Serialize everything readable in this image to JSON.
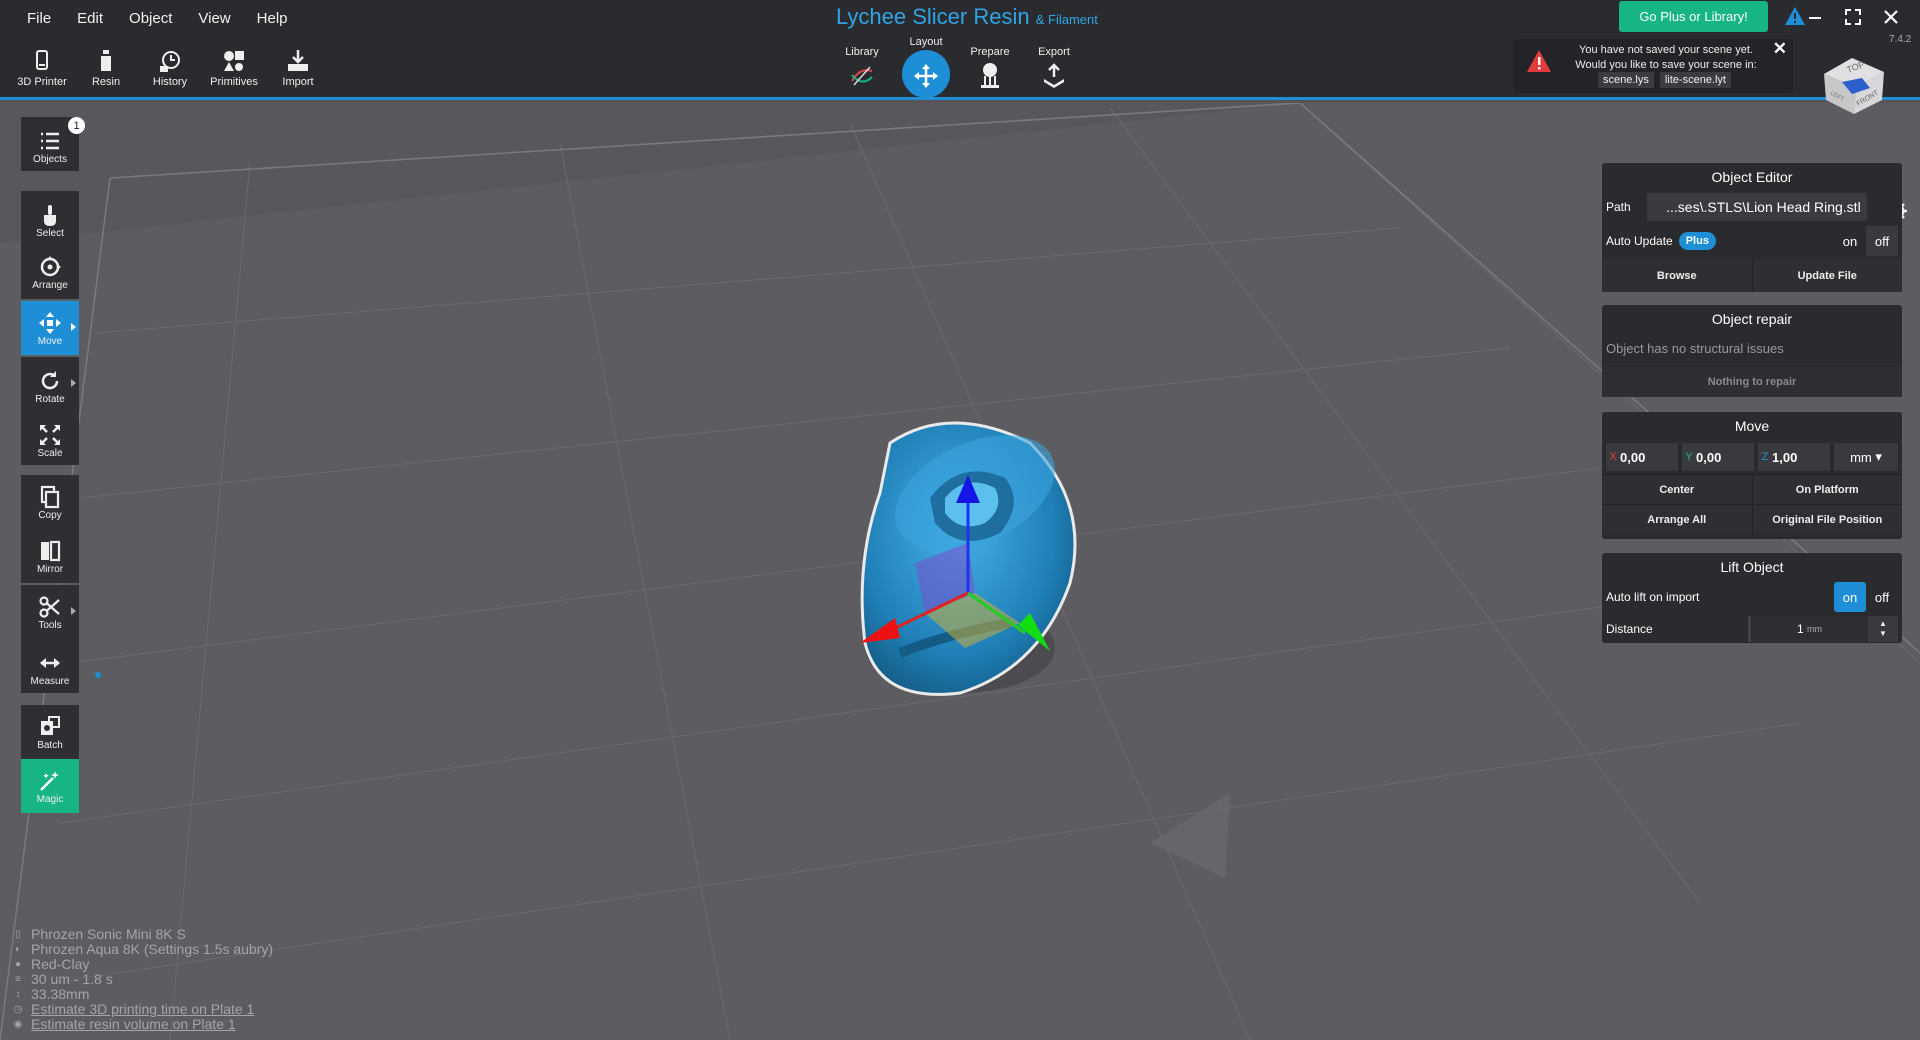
{
  "menu": [
    "File",
    "Edit",
    "Object",
    "View",
    "Help"
  ],
  "tools": [
    {
      "label": "3D Printer",
      "icon": "printer-icon"
    },
    {
      "label": "Resin",
      "icon": "resin-bottle-icon"
    },
    {
      "label": "History",
      "icon": "history-icon"
    },
    {
      "label": "Primitives",
      "icon": "primitives-icon"
    },
    {
      "label": "Import",
      "icon": "import-icon"
    }
  ],
  "app": {
    "title": "Lychee Slicer Resin",
    "suffix": "& Filament",
    "version": "7.4.2"
  },
  "workflow": [
    {
      "label": "Library",
      "icon": "library-icon"
    },
    {
      "label": "Layout",
      "icon": "move-icon",
      "active": true
    },
    {
      "label": "Prepare",
      "icon": "supports-icon"
    },
    {
      "label": "Export",
      "icon": "export-icon"
    }
  ],
  "go_plus": "Go Plus or Library!",
  "notification": {
    "message": "You have not saved your scene yet. Would you like to save your scene in:",
    "options": [
      "scene.lys",
      "lite-scene.lyt"
    ]
  },
  "view_cube": {
    "top": "TOP",
    "front": "FRONT",
    "left": "LEFT"
  },
  "sidebar": {
    "objects": {
      "label": "Objects",
      "count": "1"
    },
    "items": [
      {
        "label": "Select"
      },
      {
        "label": "Arrange"
      },
      {
        "label": "Move"
      },
      {
        "label": "Rotate"
      },
      {
        "label": "Scale"
      },
      {
        "label": "Copy"
      },
      {
        "label": "Mirror"
      },
      {
        "label": "Tools"
      },
      {
        "label": "Measure"
      },
      {
        "label": "Batch"
      },
      {
        "label": "Magic"
      }
    ]
  },
  "object_editor": {
    "title": "Object Editor",
    "path_label": "Path",
    "path_value": "...ses\\.STLS\\Lion Head Ring.stl",
    "auto_update_label": "Auto Update",
    "plus_badge": "Plus",
    "on": "on",
    "off": "off",
    "browse": "Browse",
    "update_file": "Update File"
  },
  "object_repair": {
    "title": "Object repair",
    "status": "Object has no structural issues",
    "button": "Nothing to repair"
  },
  "move": {
    "title": "Move",
    "x_label": "X",
    "x": "0,00",
    "y_label": "Y",
    "y": "0,00",
    "z_label": "Z",
    "z": "1,00",
    "unit": "mm",
    "center": "Center",
    "on_platform": "On Platform",
    "arrange_all": "Arrange All",
    "original_position": "Original File Position"
  },
  "lift_object": {
    "title": "Lift Object",
    "auto_lift_label": "Auto lift on import",
    "on": "on",
    "off": "off",
    "distance_label": "Distance",
    "distance_value": "1",
    "distance_unit": "mm"
  },
  "info": {
    "printer": "Phrozen Sonic Mini 8K S",
    "resin": "Phrozen Aqua 8K (Settings 1.5s aubry)",
    "color": "Red-Clay",
    "layer": "30 um - 1.8 s",
    "height": "33.38mm",
    "estimate_time": "Estimate 3D printing time on Plate 1",
    "estimate_volume": "Estimate resin volume on Plate 1"
  },
  "colors": {
    "accent": "#1e8fd6",
    "green": "#17b585",
    "bar": "#2a2b2e",
    "viewport": "#58585c"
  }
}
